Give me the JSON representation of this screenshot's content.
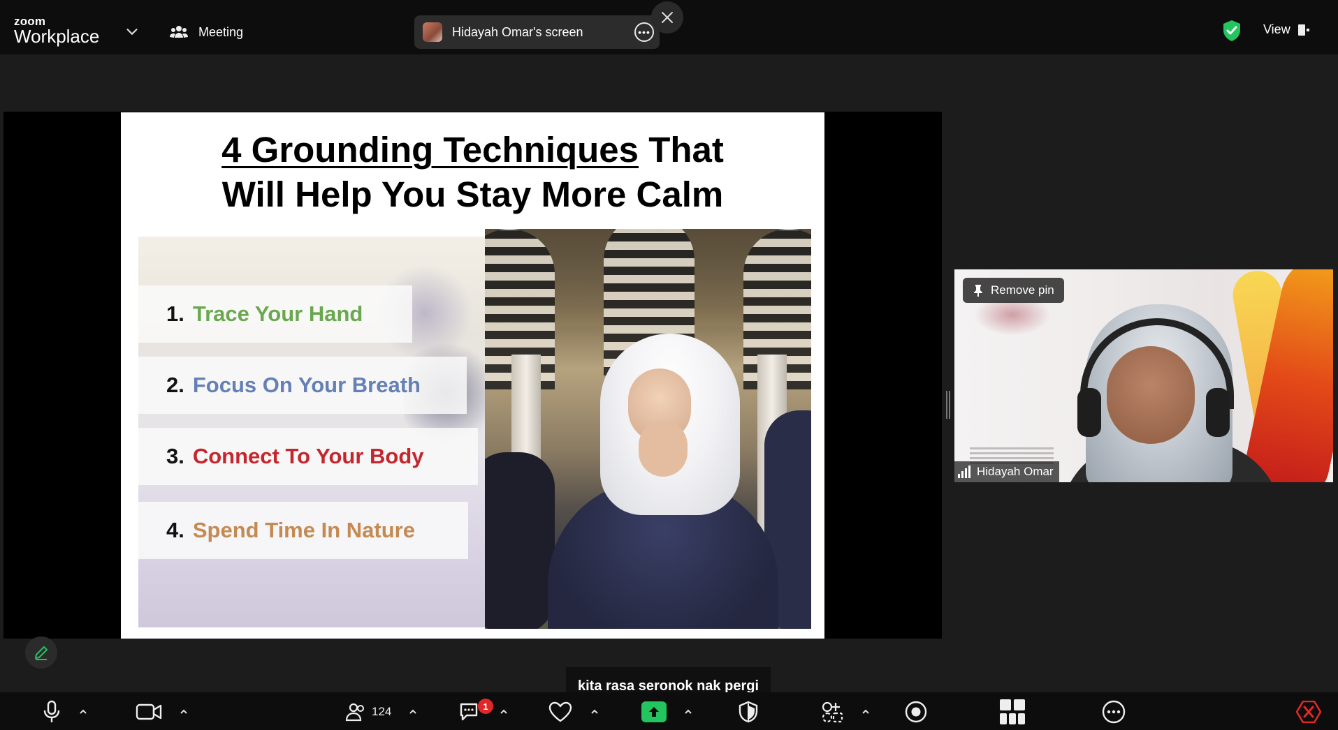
{
  "app": {
    "logo_small": "zoom",
    "logo_large": "Workplace"
  },
  "header": {
    "meeting_label": "Meeting",
    "share_pill_label": "Hidayah Omar's screen",
    "view_label": "View",
    "icons": [
      "chevron-down-icon",
      "people-icon",
      "avatar",
      "more-icon",
      "close-icon",
      "shield-check-icon",
      "view-layout-icon"
    ]
  },
  "slide": {
    "title_underlined": "4 Grounding Techniques",
    "title_rest": " That",
    "title_line2": "Will Help You Stay More Calm",
    "techniques": [
      {
        "num": "1.",
        "label": "Trace Your Hand",
        "color": "#6aa84f"
      },
      {
        "num": "2.",
        "label": "Focus On Your Breath",
        "color": "#6480b5"
      },
      {
        "num": "3.",
        "label": "Connect To Your Body",
        "color": "#c3272d"
      },
      {
        "num": "4.",
        "label": "Spend Time In Nature",
        "color": "#c48a52"
      }
    ]
  },
  "participant": {
    "name": "Hidayah Omar",
    "pin_label": "Remove pin"
  },
  "caption": {
    "text": "kita rasa seronok nak pergi"
  },
  "toolbar": {
    "participants_count": "124",
    "chat_badge": "1",
    "share_color": "#22c55e",
    "end_color": "#e02828"
  }
}
